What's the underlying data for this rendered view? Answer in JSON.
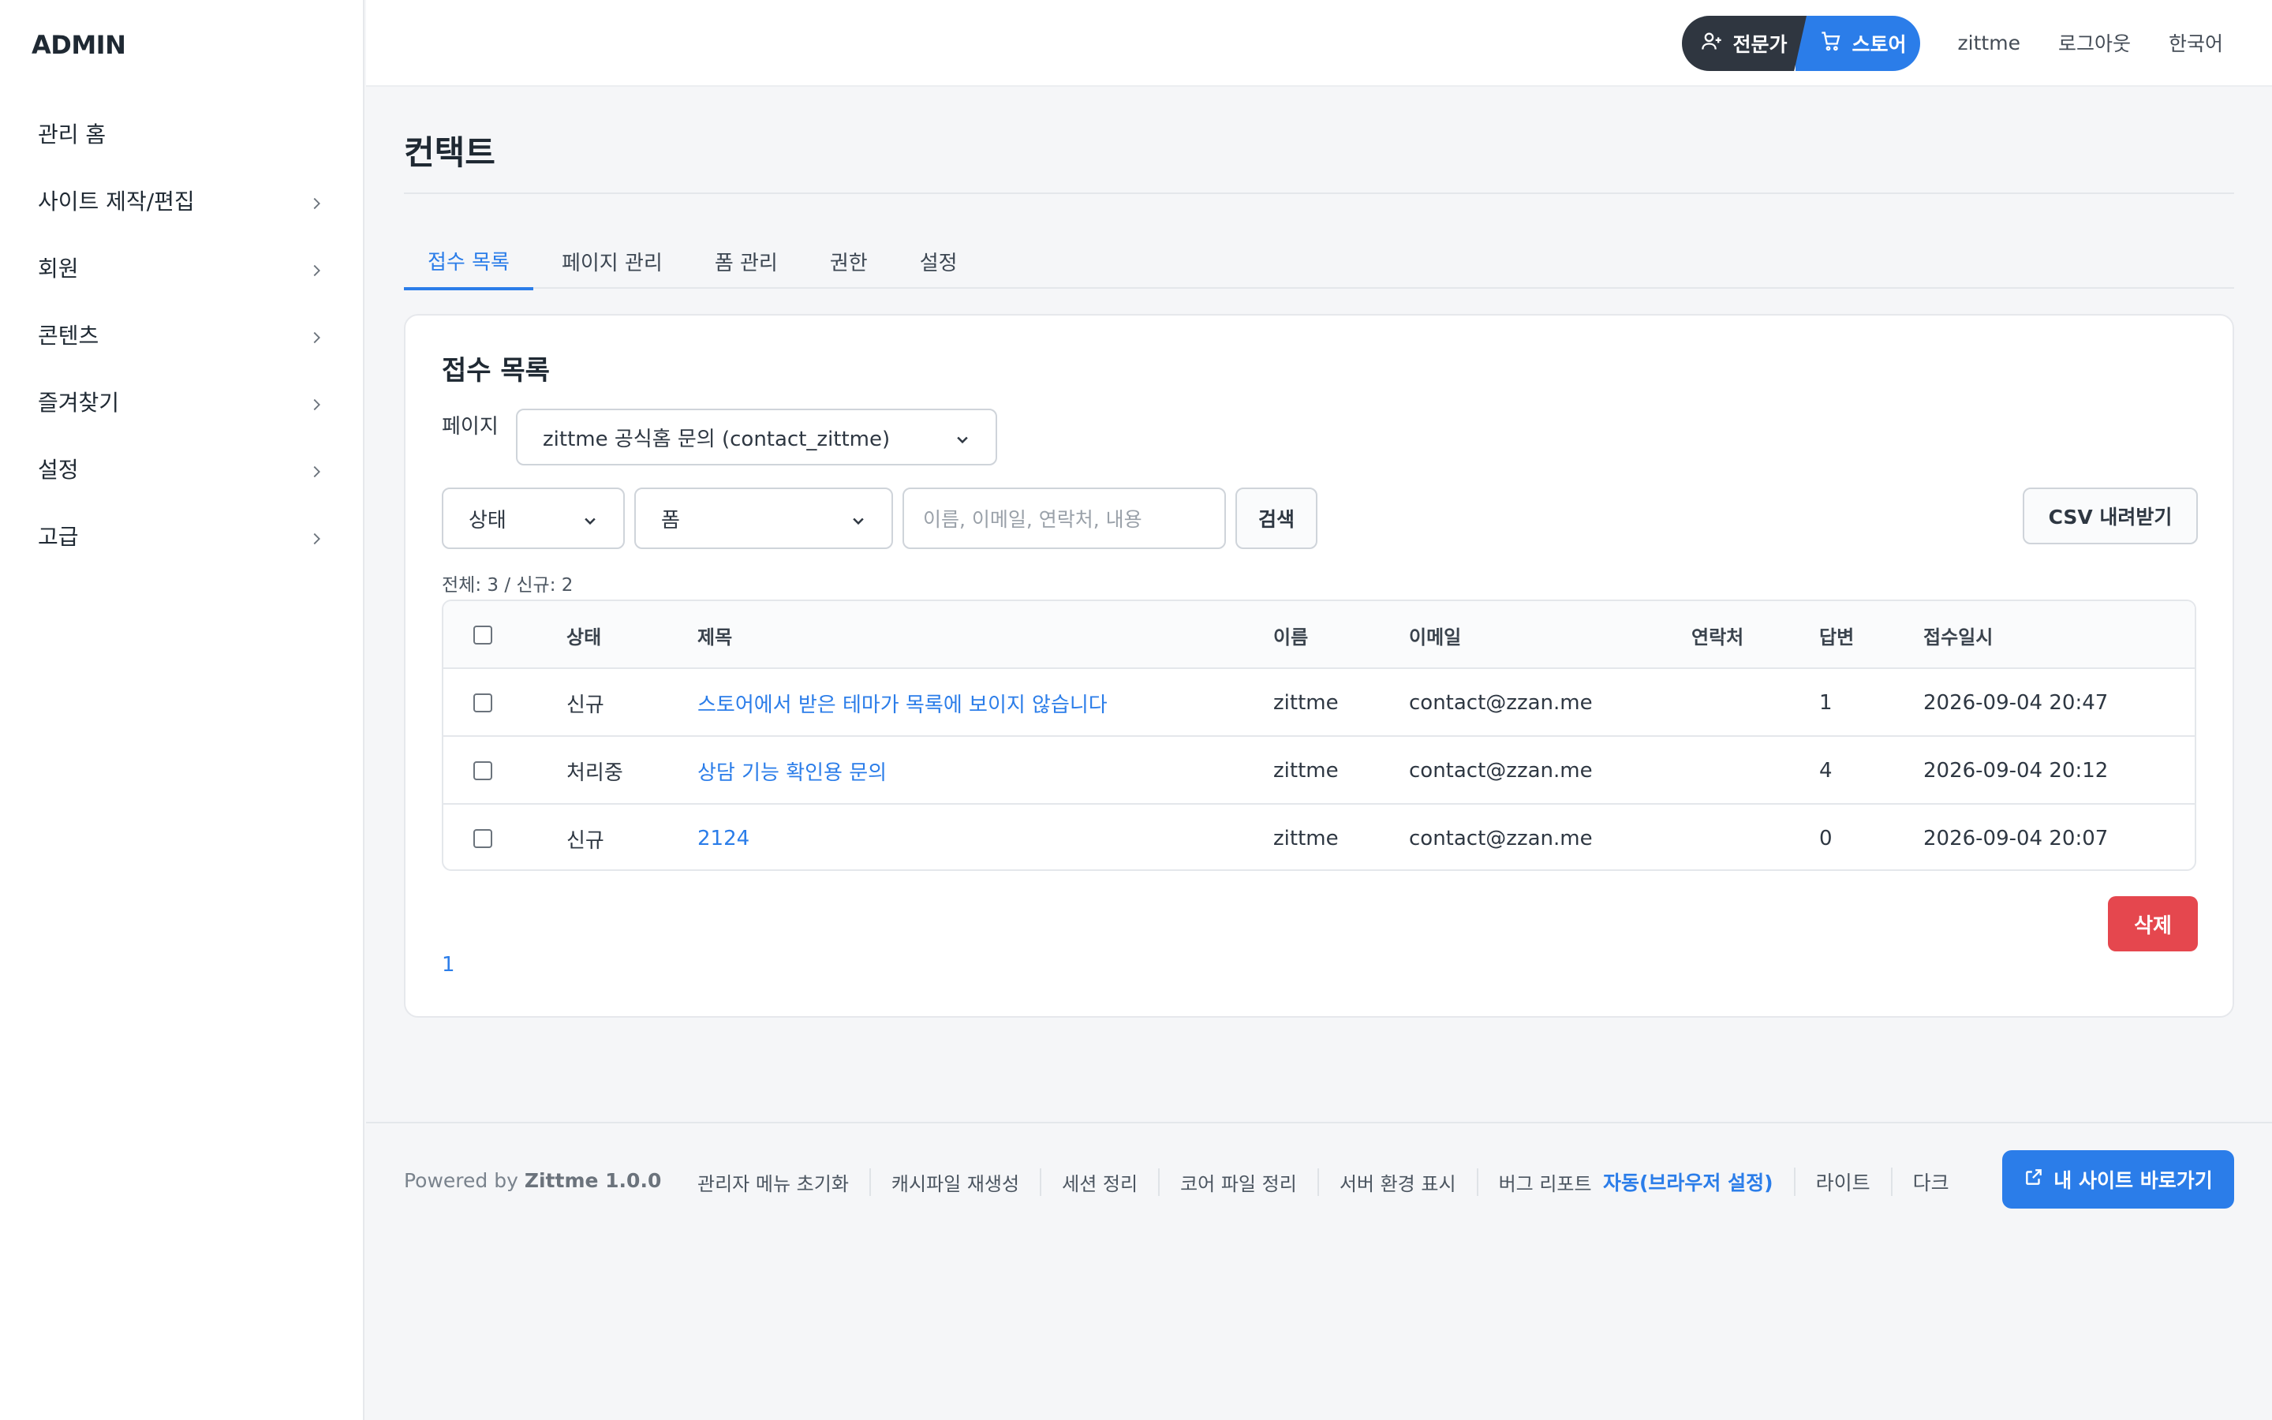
{
  "sidebar": {
    "logo": "ADMIN",
    "items": [
      {
        "label": "관리 홈",
        "has_children": false
      },
      {
        "label": "사이트 제작/편집",
        "has_children": true
      },
      {
        "label": "회원",
        "has_children": true
      },
      {
        "label": "콘텐츠",
        "has_children": true
      },
      {
        "label": "즐겨찾기",
        "has_children": true
      },
      {
        "label": "설정",
        "has_children": true
      },
      {
        "label": "고급",
        "has_children": true
      }
    ]
  },
  "topbar": {
    "expert_label": "전문가",
    "store_label": "스토어",
    "user": "zittme",
    "logout": "로그아웃",
    "language": "한국어"
  },
  "main": {
    "title": "컨택트",
    "tabs": [
      {
        "label": "접수 목록",
        "active": true
      },
      {
        "label": "페이지 관리",
        "active": false
      },
      {
        "label": "폼 관리",
        "active": false
      },
      {
        "label": "권한",
        "active": false
      },
      {
        "label": "설정",
        "active": false
      }
    ]
  },
  "card": {
    "title": "접수 목록",
    "page_label": "페이지",
    "page_select_value": "zittme 공식홈 문의 (contact_zittme)",
    "status_select_value": "상태",
    "form_select_value": "폼",
    "search_placeholder": "이름, 이메일, 연락처, 내용",
    "search_button": "검색",
    "csv_button": "CSV 내려받기",
    "summary": "전체: 3 / 신규: 2",
    "delete_button": "삭제",
    "page_number": "1"
  },
  "table": {
    "headers": {
      "status": "상태",
      "subject": "제목",
      "name": "이름",
      "email": "이메일",
      "phone": "연락처",
      "replies": "답변",
      "date": "접수일시"
    },
    "rows": [
      {
        "status": "신규",
        "subject": "스토어에서 받은 테마가 목록에 보이지 않습니다",
        "name": "zittme",
        "email": "contact@zzan.me",
        "phone": "",
        "replies": "1",
        "date": "2026-09-04 20:47"
      },
      {
        "status": "처리중",
        "subject": "상담 기능 확인용 문의",
        "name": "zittme",
        "email": "contact@zzan.me",
        "phone": "",
        "replies": "4",
        "date": "2026-09-04 20:12"
      },
      {
        "status": "신규",
        "subject": "2124",
        "name": "zittme",
        "email": "contact@zzan.me",
        "phone": "",
        "replies": "0",
        "date": "2026-09-04 20:07"
      }
    ]
  },
  "footer": {
    "powered_prefix": "Powered by",
    "powered_product": "Zittme 1.0.0",
    "links": [
      "관리자 메뉴 초기화",
      "캐시파일 재생성",
      "세션 정리",
      "코어 파일 정리",
      "서버 환경 표시",
      "버그 리포트"
    ],
    "themes": [
      {
        "label": "자동(브라우저 설정)",
        "active": true
      },
      {
        "label": "라이트",
        "active": false
      },
      {
        "label": "다크",
        "active": false
      }
    ],
    "visit_button": "내 사이트 바로가기"
  },
  "colors": {
    "accent": "#2b7de9",
    "danger": "#e5474e",
    "dark_pill": "#2f3640"
  },
  "icons": {
    "expert": "user-plus-icon",
    "store": "cart-icon",
    "chevron": "chevron-right-icon",
    "external": "external-link-icon"
  }
}
